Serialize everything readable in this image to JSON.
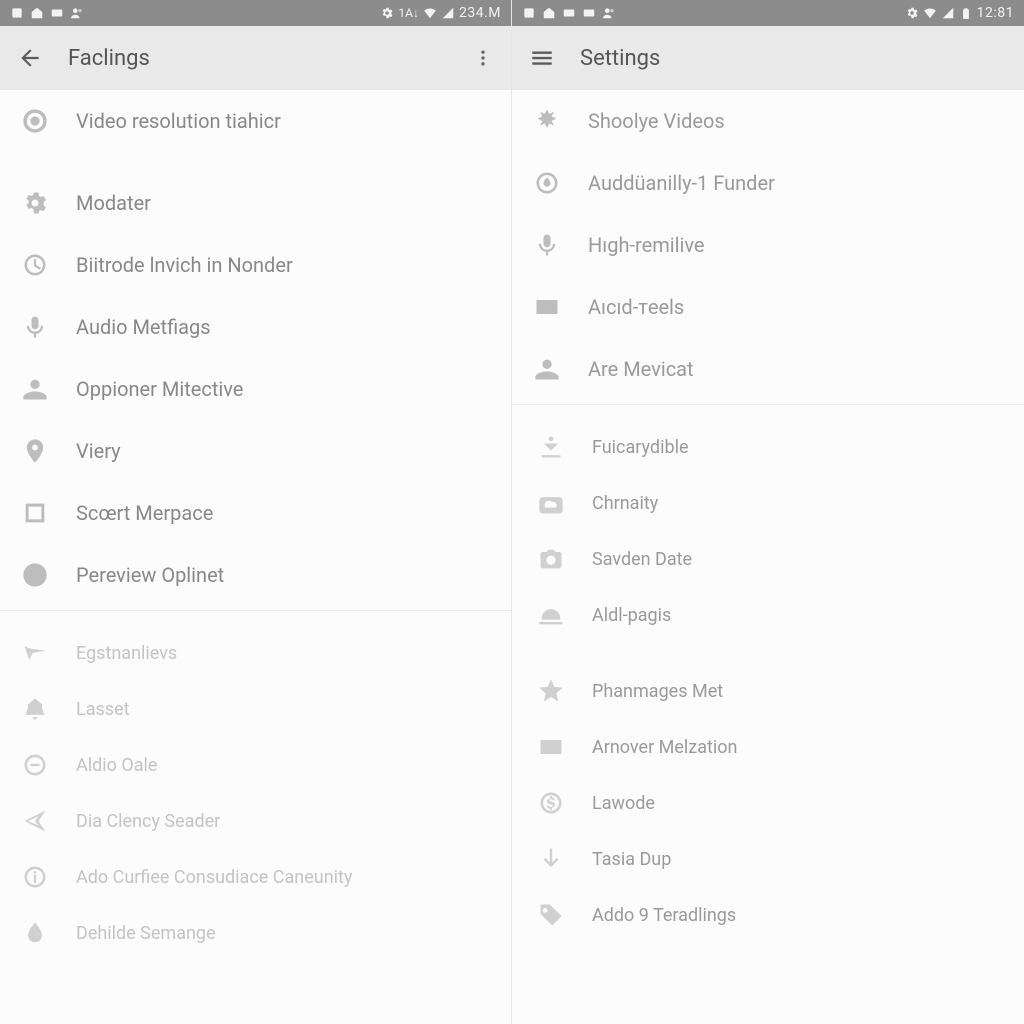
{
  "left": {
    "status": {
      "net_text": "1A↓",
      "time": "234.M"
    },
    "appbar": {
      "title": "Faclings"
    },
    "items": [
      {
        "label": "Video resolution tiahicr",
        "icon": "target",
        "strong": true
      },
      {
        "label": "Modater",
        "icon": "gear",
        "strong": true,
        "gap_before": true
      },
      {
        "label": "Biitrode lnvich in Nonder",
        "icon": "clock",
        "strong": true
      },
      {
        "label": "Audio Metfiags",
        "icon": "mic",
        "strong": true
      },
      {
        "label": "Oppioner Mitective",
        "icon": "person",
        "strong": true
      },
      {
        "label": "Viery",
        "icon": "pin",
        "strong": true
      },
      {
        "label": "Scœrt Merpace",
        "icon": "square",
        "strong": true
      },
      {
        "label": "Pereview Oplinet",
        "icon": "bolt",
        "strong": true
      },
      {
        "label": "Egstnanlievs",
        "icon": "check",
        "faded": true,
        "divider_before": true
      },
      {
        "label": "Lasset",
        "icon": "bell",
        "faded": true
      },
      {
        "label": "Aldio Oale",
        "icon": "circle-minus",
        "faded": true
      },
      {
        "label": "Dia Clency Seader",
        "icon": "send",
        "faded": true
      },
      {
        "label": "Ado Curfiee Consudiace Caneunity",
        "icon": "info",
        "faded": true
      },
      {
        "label": "Dehilde Semange",
        "icon": "drop",
        "faded": true
      }
    ]
  },
  "right": {
    "status": {
      "time": "12:81"
    },
    "appbar": {
      "title": "Settings"
    },
    "items": [
      {
        "label": "Shoolye Videos",
        "icon": "snow",
        "strong": true
      },
      {
        "label": "Auddüanilly-1 Funder",
        "icon": "flame",
        "strong": true
      },
      {
        "label": "Hıgh-remilive",
        "icon": "mic",
        "strong": true
      },
      {
        "label": "Aıcıd-тeels",
        "icon": "rect",
        "strong": true
      },
      {
        "label": "Are Mevicat",
        "icon": "person",
        "strong": true
      },
      {
        "label": "Fuicarydible",
        "icon": "download-dot",
        "faded": true,
        "divider_before": true
      },
      {
        "label": "Chrnaity",
        "icon": "cloud-box",
        "faded": true
      },
      {
        "label": "Savden Date",
        "icon": "camera",
        "faded": true
      },
      {
        "label": "Aldl-pagis",
        "icon": "helmet",
        "faded": true
      },
      {
        "label": "Phanmages Met",
        "icon": "star",
        "faded": true,
        "gap_before": true
      },
      {
        "label": "Arnover Melzation",
        "icon": "rect",
        "faded": true
      },
      {
        "label": "Lawode",
        "icon": "dollar",
        "faded": true
      },
      {
        "label": "Tasia Dup",
        "icon": "arrow-down",
        "faded": true
      },
      {
        "label": "Addo 9 Teradlings",
        "icon": "tag",
        "faded": true
      }
    ]
  }
}
